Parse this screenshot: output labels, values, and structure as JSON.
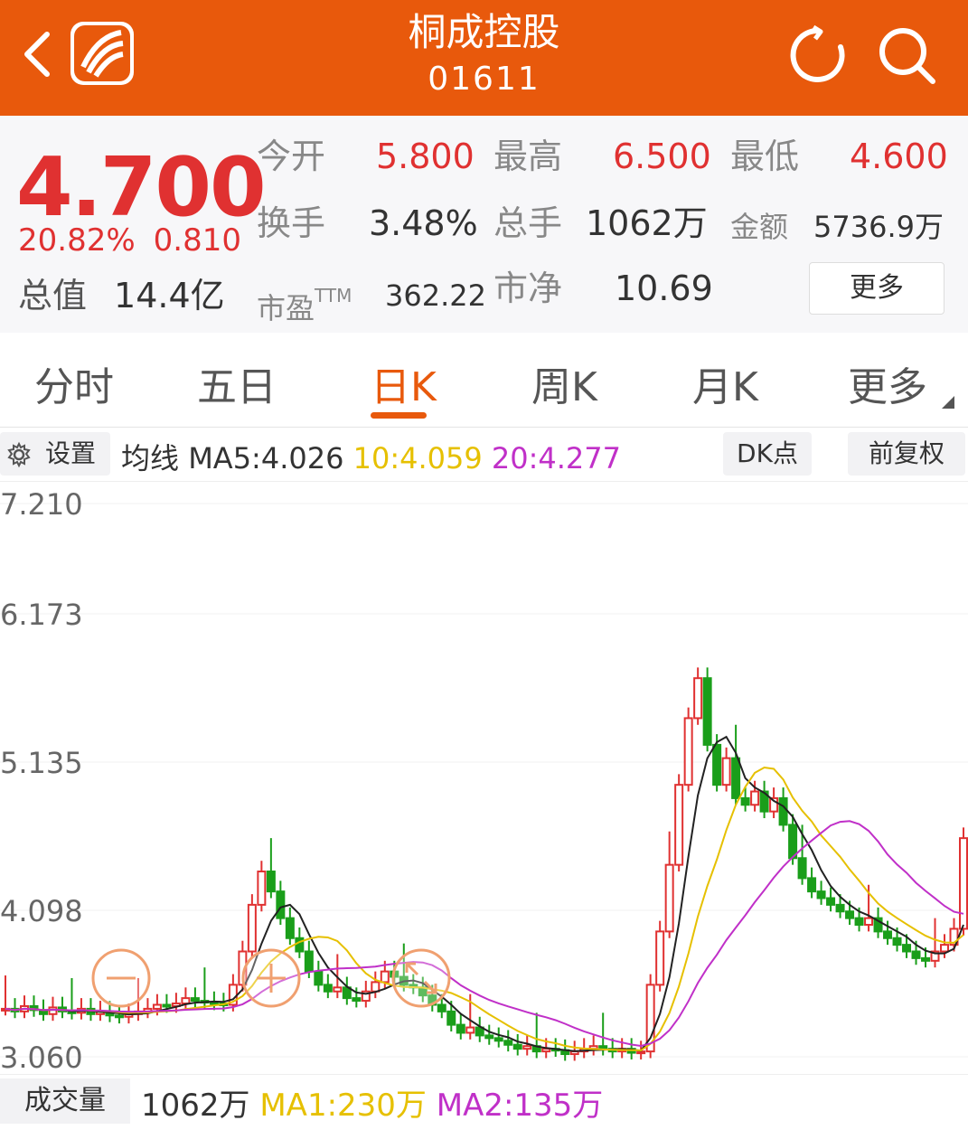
{
  "header": {
    "back_icon": "chevron-left-icon",
    "logo_icon": "app-logo-icon",
    "title": "桐成控股",
    "code": "01611",
    "refresh_icon": "refresh-icon",
    "search_icon": "search-icon",
    "bg_color": "#E8590C"
  },
  "quote": {
    "price": "4.700",
    "change_pct": "20.82%",
    "change": "0.810",
    "mcap_label": "总值",
    "mcap_value": "14.4亿",
    "open_label": "今开",
    "open": "5.800",
    "high_label": "最高",
    "high": "6.500",
    "low_label": "最低",
    "low": "4.600",
    "turnover_label": "换手",
    "turnover": "3.48%",
    "volume_label": "总手",
    "volume": "1062万",
    "amount_label": "金额",
    "amount": "5736.9万",
    "pe_label": "市盈",
    "pe_sup": "TTM",
    "pe": "362.22",
    "pb_label": "市净",
    "pb": "10.69",
    "more_label": "更多"
  },
  "tabs": [
    {
      "label": "分时"
    },
    {
      "label": "五日"
    },
    {
      "label": "日K",
      "active": true
    },
    {
      "label": "周K"
    },
    {
      "label": "月K"
    },
    {
      "label": "更多"
    }
  ],
  "ma_bar": {
    "settings_icon": "gear-icon",
    "settings_label": "设置",
    "prefix": "均线",
    "ma5": "MA5:4.026",
    "ma10": "10:4.059",
    "ma20": "20:4.277",
    "dk_label": "DK点",
    "adjust_label": "前复权"
  },
  "chart": {
    "y_ticks": [
      "7.210",
      "6.173",
      "5.135",
      "4.098",
      "3.060"
    ],
    "zoom_out_icon": "zoom-out-icon",
    "zoom_in_icon": "zoom-in-icon",
    "expand_icon": "expand-icon"
  },
  "volume_bar": {
    "button_label": "成交量",
    "value": "1062万",
    "ma1": "MA1:230万",
    "ma2": "MA2:135万"
  }
}
